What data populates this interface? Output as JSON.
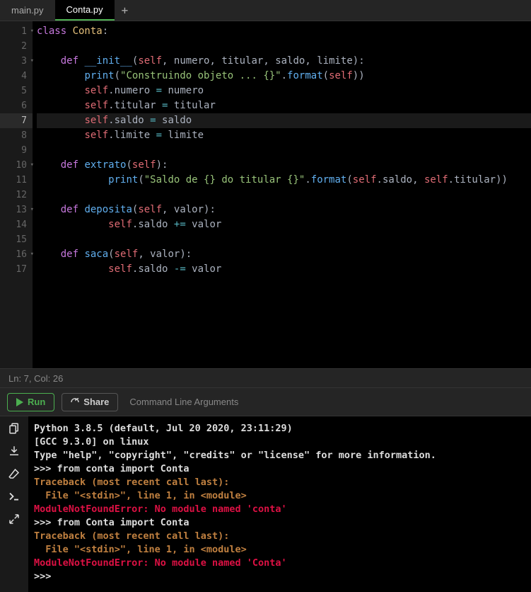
{
  "tabs": {
    "items": [
      {
        "label": "main.py",
        "active": false
      },
      {
        "label": "Conta.py",
        "active": true
      }
    ]
  },
  "code": {
    "lines": [
      {
        "n": 1,
        "fold": true,
        "tokens": [
          [
            "kw",
            "class "
          ],
          [
            "cls",
            "Conta"
          ],
          [
            "pnc",
            ":"
          ]
        ]
      },
      {
        "n": 2,
        "tokens": []
      },
      {
        "n": 3,
        "fold": true,
        "tokens": [
          [
            "pln",
            "    "
          ],
          [
            "kw",
            "def "
          ],
          [
            "mg",
            "__init__"
          ],
          [
            "pnc",
            "("
          ],
          [
            "slf",
            "self"
          ],
          [
            "pnc",
            ", "
          ],
          [
            "prm",
            "numero"
          ],
          [
            "pnc",
            ", "
          ],
          [
            "prm",
            "titular"
          ],
          [
            "pnc",
            ", "
          ],
          [
            "prm",
            "saldo"
          ],
          [
            "pnc",
            ", "
          ],
          [
            "prm",
            "limite"
          ],
          [
            "pnc",
            "):"
          ]
        ]
      },
      {
        "n": 4,
        "tokens": [
          [
            "pln",
            "        "
          ],
          [
            "fn",
            "print"
          ],
          [
            "pnc",
            "("
          ],
          [
            "str",
            "\"Construindo objeto ... {}\""
          ],
          [
            "pnc",
            "."
          ],
          [
            "fn",
            "format"
          ],
          [
            "pnc",
            "("
          ],
          [
            "slf",
            "self"
          ],
          [
            "pnc",
            "))"
          ]
        ]
      },
      {
        "n": 5,
        "tokens": [
          [
            "pln",
            "        "
          ],
          [
            "slf",
            "self"
          ],
          [
            "pnc",
            "."
          ],
          [
            "pln",
            "numero "
          ],
          [
            "op",
            "="
          ],
          [
            "pln",
            " numero"
          ]
        ]
      },
      {
        "n": 6,
        "tokens": [
          [
            "pln",
            "        "
          ],
          [
            "slf",
            "self"
          ],
          [
            "pnc",
            "."
          ],
          [
            "pln",
            "titular "
          ],
          [
            "op",
            "="
          ],
          [
            "pln",
            " titular"
          ]
        ]
      },
      {
        "n": 7,
        "hl": true,
        "tokens": [
          [
            "pln",
            "        "
          ],
          [
            "slf",
            "self"
          ],
          [
            "pnc",
            "."
          ],
          [
            "pln",
            "saldo "
          ],
          [
            "op",
            "="
          ],
          [
            "pln",
            " saldo"
          ]
        ]
      },
      {
        "n": 8,
        "tokens": [
          [
            "pln",
            "        "
          ],
          [
            "slf",
            "self"
          ],
          [
            "pnc",
            "."
          ],
          [
            "pln",
            "limite "
          ],
          [
            "op",
            "="
          ],
          [
            "pln",
            " limite"
          ]
        ]
      },
      {
        "n": 9,
        "tokens": []
      },
      {
        "n": 10,
        "fold": true,
        "tokens": [
          [
            "pln",
            "    "
          ],
          [
            "kw",
            "def "
          ],
          [
            "fn",
            "extrato"
          ],
          [
            "pnc",
            "("
          ],
          [
            "slf",
            "self"
          ],
          [
            "pnc",
            "):"
          ]
        ]
      },
      {
        "n": 11,
        "tokens": [
          [
            "pln",
            "            "
          ],
          [
            "fn",
            "print"
          ],
          [
            "pnc",
            "("
          ],
          [
            "str",
            "\"Saldo de {} do titular {}\""
          ],
          [
            "pnc",
            "."
          ],
          [
            "fn",
            "format"
          ],
          [
            "pnc",
            "("
          ],
          [
            "slf",
            "self"
          ],
          [
            "pnc",
            "."
          ],
          [
            "pln",
            "saldo"
          ],
          [
            "pnc",
            ", "
          ],
          [
            "slf",
            "self"
          ],
          [
            "pnc",
            "."
          ],
          [
            "pln",
            "titular"
          ],
          [
            "pnc",
            "))"
          ]
        ]
      },
      {
        "n": 12,
        "tokens": []
      },
      {
        "n": 13,
        "fold": true,
        "tokens": [
          [
            "pln",
            "    "
          ],
          [
            "kw",
            "def "
          ],
          [
            "fn",
            "deposita"
          ],
          [
            "pnc",
            "("
          ],
          [
            "slf",
            "self"
          ],
          [
            "pnc",
            ", "
          ],
          [
            "prm",
            "valor"
          ],
          [
            "pnc",
            "):"
          ]
        ]
      },
      {
        "n": 14,
        "tokens": [
          [
            "pln",
            "            "
          ],
          [
            "slf",
            "self"
          ],
          [
            "pnc",
            "."
          ],
          [
            "pln",
            "saldo "
          ],
          [
            "op",
            "+="
          ],
          [
            "pln",
            " valor"
          ]
        ]
      },
      {
        "n": 15,
        "tokens": []
      },
      {
        "n": 16,
        "fold": true,
        "tokens": [
          [
            "pln",
            "    "
          ],
          [
            "kw",
            "def "
          ],
          [
            "fn",
            "saca"
          ],
          [
            "pnc",
            "("
          ],
          [
            "slf",
            "self"
          ],
          [
            "pnc",
            ", "
          ],
          [
            "prm",
            "valor"
          ],
          [
            "pnc",
            "):"
          ]
        ]
      },
      {
        "n": 17,
        "tokens": [
          [
            "pln",
            "            "
          ],
          [
            "slf",
            "self"
          ],
          [
            "pnc",
            "."
          ],
          [
            "pln",
            "saldo "
          ],
          [
            "op",
            "-="
          ],
          [
            "pln",
            " valor"
          ]
        ]
      }
    ]
  },
  "status": {
    "text": "Ln: 7,  Col: 26"
  },
  "toolbar": {
    "run_label": "Run",
    "share_label": "Share",
    "cla_label": "Command Line Arguments"
  },
  "console": {
    "lines": [
      {
        "cls": "",
        "text": "Python 3.8.5 (default, Jul 20 2020, 23:11:29)"
      },
      {
        "cls": "",
        "text": "[GCC 9.3.0] on linux"
      },
      {
        "cls": "",
        "text": "Type \"help\", \"copyright\", \"credits\" or \"license\" for more information."
      },
      {
        "cls": "",
        "text": ">>> from conta import Conta"
      },
      {
        "cls": "warn",
        "text": "Traceback (most recent call last):"
      },
      {
        "cls": "warn",
        "text": "  File \"<stdin>\", line 1, in <module>"
      },
      {
        "cls": "err",
        "text": "ModuleNotFoundError: No module named 'conta'"
      },
      {
        "cls": "",
        "text": ">>> from Conta import Conta"
      },
      {
        "cls": "warn",
        "text": "Traceback (most recent call last):"
      },
      {
        "cls": "warn",
        "text": "  File \"<stdin>\", line 1, in <module>"
      },
      {
        "cls": "err",
        "text": "ModuleNotFoundError: No module named 'Conta'"
      },
      {
        "cls": "",
        "text": ">>> "
      }
    ]
  }
}
